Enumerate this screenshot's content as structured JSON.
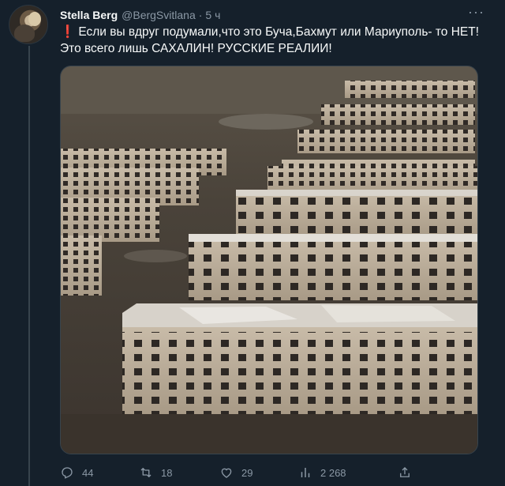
{
  "tweet": {
    "author_name": "Stella Berg",
    "author_handle": "@BergSvitlana",
    "separator": "·",
    "time": "5 ч",
    "more": "···",
    "line1": "Если вы вдруг подумали,что это Буча,Бахмут или Мариуполь- то НЕТ!",
    "line2": "Это всего лишь САХАЛИН! РУССКИЕ РЕАЛИИ!",
    "exclamation": "❗",
    "accent_color": "#e0245e",
    "background_color": "#15202b"
  },
  "actions": {
    "replies": "44",
    "retweets": "18",
    "likes": "29",
    "views": "2 268"
  },
  "icons": {
    "reply": "reply-icon",
    "retweet": "retweet-icon",
    "like": "heart-icon",
    "views": "analytics-icon",
    "share": "share-icon",
    "more": "more-icon"
  }
}
